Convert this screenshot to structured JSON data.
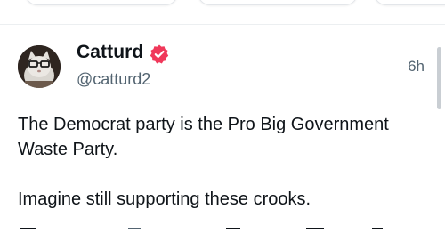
{
  "post": {
    "author_name": "Catturd",
    "handle": "@catturd2",
    "timestamp": "6h",
    "paragraphs": [
      "The Democrat party is the Pro Big Government Waste Party.",
      "Imagine still supporting these crooks."
    ]
  },
  "colors": {
    "verified_badge": "#f0385a",
    "secondary_text": "#536471",
    "primary_text": "#0f1419"
  },
  "icons": {
    "verified": "verified-badge-icon",
    "reply": "reply-icon",
    "repost": "repost-icon",
    "like": "like-icon",
    "bookmark": "bookmark-icon",
    "share": "share-icon"
  }
}
